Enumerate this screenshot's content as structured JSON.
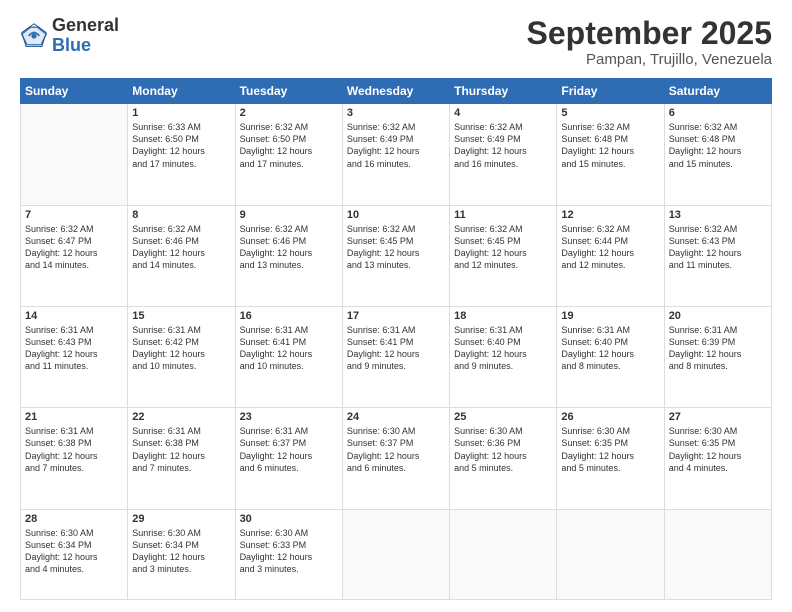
{
  "logo": {
    "general": "General",
    "blue": "Blue"
  },
  "header": {
    "month": "September 2025",
    "location": "Pampan, Trujillo, Venezuela"
  },
  "weekdays": [
    "Sunday",
    "Monday",
    "Tuesday",
    "Wednesday",
    "Thursday",
    "Friday",
    "Saturday"
  ],
  "weeks": [
    [
      {
        "day": "",
        "info": ""
      },
      {
        "day": "1",
        "info": "Sunrise: 6:33 AM\nSunset: 6:50 PM\nDaylight: 12 hours\nand 17 minutes."
      },
      {
        "day": "2",
        "info": "Sunrise: 6:32 AM\nSunset: 6:50 PM\nDaylight: 12 hours\nand 17 minutes."
      },
      {
        "day": "3",
        "info": "Sunrise: 6:32 AM\nSunset: 6:49 PM\nDaylight: 12 hours\nand 16 minutes."
      },
      {
        "day": "4",
        "info": "Sunrise: 6:32 AM\nSunset: 6:49 PM\nDaylight: 12 hours\nand 16 minutes."
      },
      {
        "day": "5",
        "info": "Sunrise: 6:32 AM\nSunset: 6:48 PM\nDaylight: 12 hours\nand 15 minutes."
      },
      {
        "day": "6",
        "info": "Sunrise: 6:32 AM\nSunset: 6:48 PM\nDaylight: 12 hours\nand 15 minutes."
      }
    ],
    [
      {
        "day": "7",
        "info": "Sunrise: 6:32 AM\nSunset: 6:47 PM\nDaylight: 12 hours\nand 14 minutes."
      },
      {
        "day": "8",
        "info": "Sunrise: 6:32 AM\nSunset: 6:46 PM\nDaylight: 12 hours\nand 14 minutes."
      },
      {
        "day": "9",
        "info": "Sunrise: 6:32 AM\nSunset: 6:46 PM\nDaylight: 12 hours\nand 13 minutes."
      },
      {
        "day": "10",
        "info": "Sunrise: 6:32 AM\nSunset: 6:45 PM\nDaylight: 12 hours\nand 13 minutes."
      },
      {
        "day": "11",
        "info": "Sunrise: 6:32 AM\nSunset: 6:45 PM\nDaylight: 12 hours\nand 12 minutes."
      },
      {
        "day": "12",
        "info": "Sunrise: 6:32 AM\nSunset: 6:44 PM\nDaylight: 12 hours\nand 12 minutes."
      },
      {
        "day": "13",
        "info": "Sunrise: 6:32 AM\nSunset: 6:43 PM\nDaylight: 12 hours\nand 11 minutes."
      }
    ],
    [
      {
        "day": "14",
        "info": "Sunrise: 6:31 AM\nSunset: 6:43 PM\nDaylight: 12 hours\nand 11 minutes."
      },
      {
        "day": "15",
        "info": "Sunrise: 6:31 AM\nSunset: 6:42 PM\nDaylight: 12 hours\nand 10 minutes."
      },
      {
        "day": "16",
        "info": "Sunrise: 6:31 AM\nSunset: 6:41 PM\nDaylight: 12 hours\nand 10 minutes."
      },
      {
        "day": "17",
        "info": "Sunrise: 6:31 AM\nSunset: 6:41 PM\nDaylight: 12 hours\nand 9 minutes."
      },
      {
        "day": "18",
        "info": "Sunrise: 6:31 AM\nSunset: 6:40 PM\nDaylight: 12 hours\nand 9 minutes."
      },
      {
        "day": "19",
        "info": "Sunrise: 6:31 AM\nSunset: 6:40 PM\nDaylight: 12 hours\nand 8 minutes."
      },
      {
        "day": "20",
        "info": "Sunrise: 6:31 AM\nSunset: 6:39 PM\nDaylight: 12 hours\nand 8 minutes."
      }
    ],
    [
      {
        "day": "21",
        "info": "Sunrise: 6:31 AM\nSunset: 6:38 PM\nDaylight: 12 hours\nand 7 minutes."
      },
      {
        "day": "22",
        "info": "Sunrise: 6:31 AM\nSunset: 6:38 PM\nDaylight: 12 hours\nand 7 minutes."
      },
      {
        "day": "23",
        "info": "Sunrise: 6:31 AM\nSunset: 6:37 PM\nDaylight: 12 hours\nand 6 minutes."
      },
      {
        "day": "24",
        "info": "Sunrise: 6:30 AM\nSunset: 6:37 PM\nDaylight: 12 hours\nand 6 minutes."
      },
      {
        "day": "25",
        "info": "Sunrise: 6:30 AM\nSunset: 6:36 PM\nDaylight: 12 hours\nand 5 minutes."
      },
      {
        "day": "26",
        "info": "Sunrise: 6:30 AM\nSunset: 6:35 PM\nDaylight: 12 hours\nand 5 minutes."
      },
      {
        "day": "27",
        "info": "Sunrise: 6:30 AM\nSunset: 6:35 PM\nDaylight: 12 hours\nand 4 minutes."
      }
    ],
    [
      {
        "day": "28",
        "info": "Sunrise: 6:30 AM\nSunset: 6:34 PM\nDaylight: 12 hours\nand 4 minutes."
      },
      {
        "day": "29",
        "info": "Sunrise: 6:30 AM\nSunset: 6:34 PM\nDaylight: 12 hours\nand 3 minutes."
      },
      {
        "day": "30",
        "info": "Sunrise: 6:30 AM\nSunset: 6:33 PM\nDaylight: 12 hours\nand 3 minutes."
      },
      {
        "day": "",
        "info": ""
      },
      {
        "day": "",
        "info": ""
      },
      {
        "day": "",
        "info": ""
      },
      {
        "day": "",
        "info": ""
      }
    ]
  ]
}
